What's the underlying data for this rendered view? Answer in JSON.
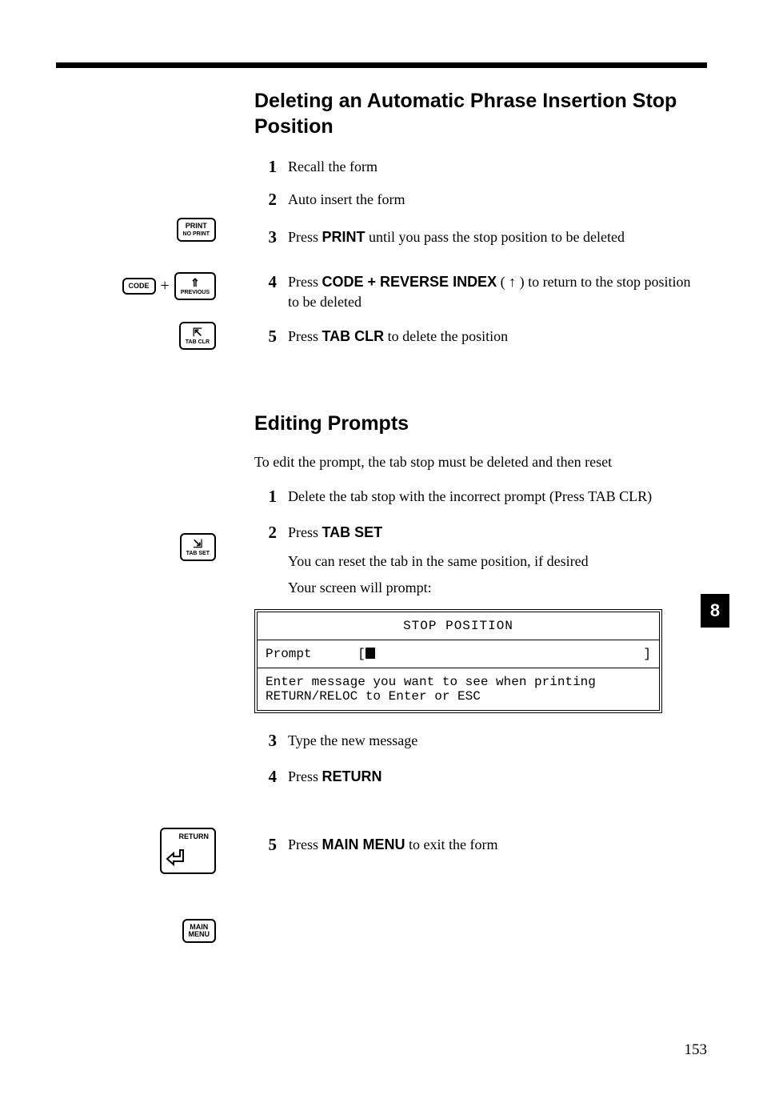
{
  "section1": {
    "heading": "Deleting an Automatic Phrase Insertion Stop Position",
    "steps": [
      {
        "n": "1",
        "parts": [
          {
            "t": "Recall the form"
          }
        ]
      },
      {
        "n": "2",
        "parts": [
          {
            "t": "Auto insert the form"
          }
        ]
      },
      {
        "n": "3",
        "parts": [
          {
            "t": "Press "
          },
          {
            "b": "PRINT"
          },
          {
            "t": " until you pass the stop position to be deleted"
          }
        ]
      },
      {
        "n": "4",
        "parts": [
          {
            "t": "Press "
          },
          {
            "b": "CODE + REVERSE INDEX"
          },
          {
            "t": " ( ↑ ) to return to the stop position to be deleted"
          }
        ]
      },
      {
        "n": "5",
        "parts": [
          {
            "t": "Press "
          },
          {
            "b": "TAB CLR"
          },
          {
            "t": " to delete the position"
          }
        ]
      }
    ]
  },
  "section2": {
    "heading": "Editing Prompts",
    "intro": "To edit the prompt, the tab stop must be deleted and then reset",
    "steps_a": [
      {
        "n": "1",
        "parts": [
          {
            "t": "Delete the tab stop with the incorrect prompt (Press TAB CLR)"
          }
        ]
      },
      {
        "n": "2",
        "parts": [
          {
            "t": "Press "
          },
          {
            "b": "TAB SET"
          }
        ]
      }
    ],
    "note1": "You can reset the tab in the same position, if desired",
    "note2": "Your screen will prompt:",
    "screen": {
      "title": "STOP POSITION",
      "label": "Prompt",
      "left_bracket": "[",
      "right_bracket": "]",
      "hint1": "Enter message you want to see when printing",
      "hint2": "RETURN/RELOC to Enter or ESC"
    },
    "steps_b": [
      {
        "n": "3",
        "parts": [
          {
            "t": "Type the new message"
          }
        ]
      },
      {
        "n": "4",
        "parts": [
          {
            "t": "Press "
          },
          {
            "b": "RETURN"
          }
        ]
      },
      {
        "n": "5",
        "parts": [
          {
            "t": "Press "
          },
          {
            "b": "MAIN MENU"
          },
          {
            "t": " to exit the form"
          }
        ]
      }
    ]
  },
  "keys": {
    "print_line1": "PRINT",
    "print_line2": "NO PRINT",
    "code": "CODE",
    "previous": "PREVIOUS",
    "tabclr": "TAB CLR",
    "tabset": "TAB SET",
    "return": "RETURN",
    "main_line1": "MAIN",
    "main_line2": "MENU"
  },
  "tab_badge": "8",
  "page_number": "153"
}
